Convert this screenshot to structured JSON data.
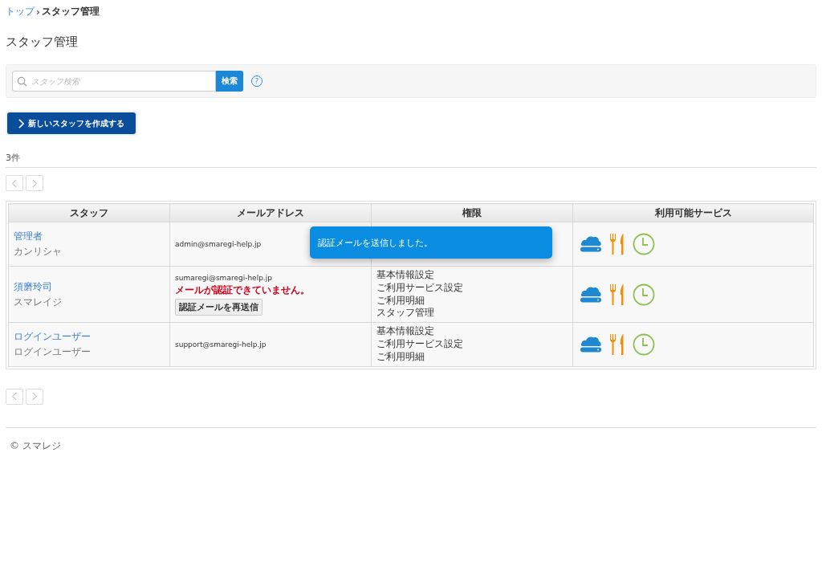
{
  "breadcrumb": [
    {
      "label": "トップ",
      "link": true
    },
    {
      "label": "スタッフ管理",
      "link": false
    }
  ],
  "breadcrumb_separator": "›",
  "title": "スタッフ管理",
  "search": {
    "placeholder": "スタッフ検索",
    "button": "検索",
    "help": "?"
  },
  "create_button": "新しいスタッフを作成する",
  "count": "3件",
  "table": {
    "columns": [
      "スタッフ",
      "メールアドレス",
      "権限",
      "利用可能サービス"
    ],
    "rows": [
      {
        "name": "管理者",
        "kana": "カンリシャ",
        "email": "admin@smaregi-help.jp",
        "services": [
          {
            "kind": "cloud"
          },
          {
            "kind": "cutlery"
          },
          {
            "kind": "clock"
          }
        ]
      },
      {
        "name": "須磨玲司",
        "kana": "スマレイジ",
        "email": "sumaregi@smaregi-help.jp",
        "warning": "メールが認証できていません。",
        "resend_button": "認証メールを再送信",
        "permissions": [
          "基本情報設定",
          "ご利用サービス設定",
          "ご利用明細",
          "スタッフ管理"
        ],
        "services": [
          {
            "kind": "cloud"
          },
          {
            "kind": "cutlery"
          },
          {
            "kind": "clock"
          }
        ]
      },
      {
        "name": "ログインユーザー",
        "kana": "ログインユーザー",
        "email": "support@smaregi-help.jp",
        "permissions": [
          "基本情報設定",
          "ご利用サービス設定",
          "ご利用明細"
        ],
        "services": [
          {
            "kind": "cloud"
          },
          {
            "kind": "cutlery"
          },
          {
            "kind": "clock"
          }
        ]
      }
    ]
  },
  "toast": "認証メールを送信しました。",
  "footer": "© スマレジ"
}
